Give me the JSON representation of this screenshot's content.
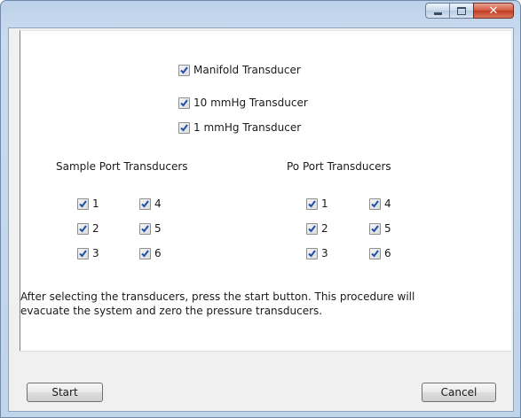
{
  "window": {
    "title": "",
    "controls": {
      "minimize": "minimize-icon",
      "maximize": "maximize-icon",
      "close": "close-icon"
    }
  },
  "transducers": [
    {
      "label": "Manifold Transducer",
      "checked": true
    },
    {
      "label": "10 mmHg Transducer",
      "checked": true
    },
    {
      "label": "1 mmHg Transducer",
      "checked": true
    }
  ],
  "sample_port": {
    "title": "Sample Port Transducers",
    "items": [
      {
        "label": "1",
        "checked": true
      },
      {
        "label": "2",
        "checked": true
      },
      {
        "label": "3",
        "checked": true
      },
      {
        "label": "4",
        "checked": true
      },
      {
        "label": "5",
        "checked": true
      },
      {
        "label": "6",
        "checked": true
      }
    ]
  },
  "po_port": {
    "title": "Po Port Transducers",
    "items": [
      {
        "label": "1",
        "checked": true
      },
      {
        "label": "2",
        "checked": true
      },
      {
        "label": "3",
        "checked": true
      },
      {
        "label": "4",
        "checked": true
      },
      {
        "label": "5",
        "checked": true
      },
      {
        "label": "6",
        "checked": true
      }
    ]
  },
  "instructions": "After selecting the transducers, press the start button. This procedure will\nevacuate the system and zero the pressure transducers.",
  "status_text": "",
  "buttons": {
    "start": "Start",
    "cancel": "Cancel"
  },
  "colors": {
    "check": "#1f4fa8",
    "close_button": "#c9452a"
  }
}
